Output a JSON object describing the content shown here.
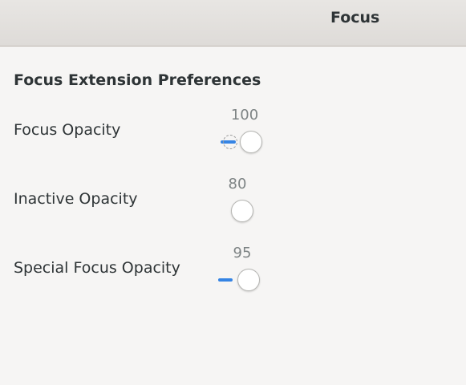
{
  "window": {
    "title": "Focus"
  },
  "preferences": {
    "heading": "Focus Extension Preferences",
    "items": [
      {
        "label": "Focus Opacity",
        "value": "100",
        "fraction": 1.0,
        "focused": true
      },
      {
        "label": "Inactive Opacity",
        "value": "80",
        "fraction": 0.8,
        "focused": false
      },
      {
        "label": "Special Focus Opacity",
        "value": "95",
        "fraction": 0.95,
        "focused": false
      }
    ]
  },
  "colors": {
    "accent": "#3584e4",
    "background": "#f6f5f4",
    "headerbar": "#e3e0dd",
    "text": "#2e3436",
    "value_text": "#7d8384"
  }
}
